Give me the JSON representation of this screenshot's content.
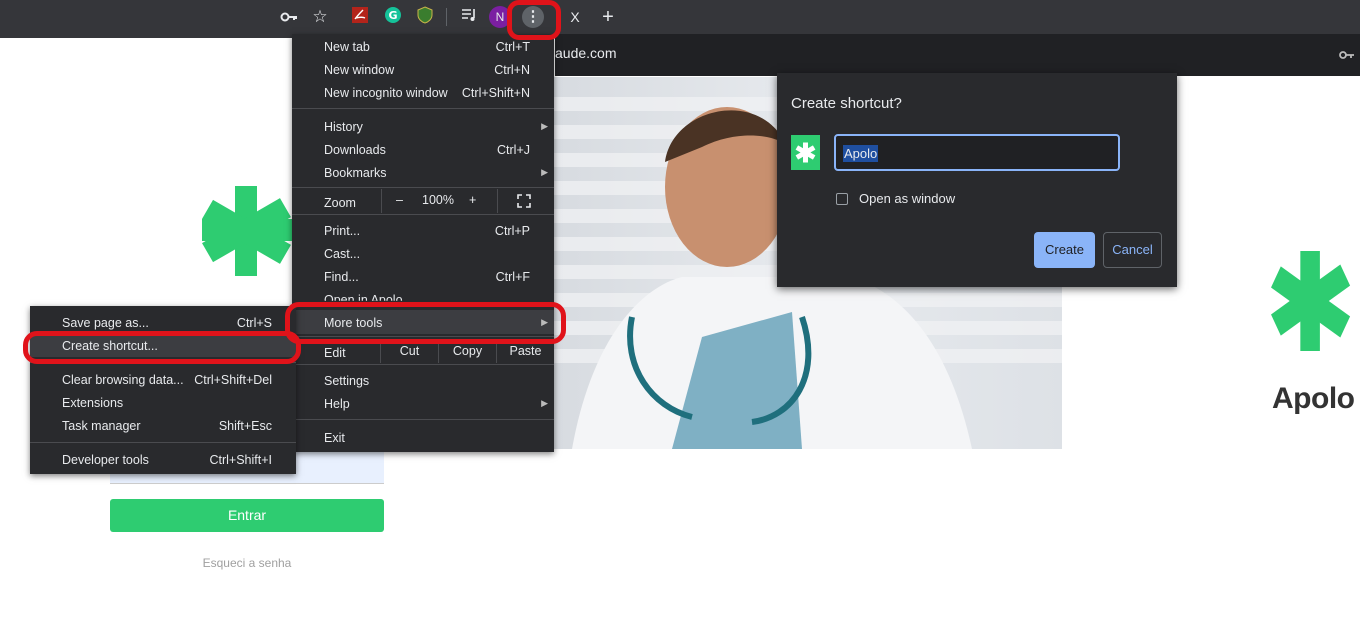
{
  "toolbar": {
    "icons": [
      "key-icon",
      "star-icon",
      "pdf-extension-icon",
      "grammarly-icon",
      "shield-extension-icon",
      "media-control-icon",
      "profile-avatar",
      "menu-dots-icon"
    ],
    "profile_initial": "N",
    "tab_close": "X",
    "new_tab": "+"
  },
  "address": {
    "text": "aude.com"
  },
  "main_menu": {
    "items": [
      {
        "label": "New tab",
        "shortcut": "Ctrl+T"
      },
      {
        "label": "New window",
        "shortcut": "Ctrl+N"
      },
      {
        "label": "New incognito window",
        "shortcut": "Ctrl+Shift+N"
      },
      {
        "label": "History"
      },
      {
        "label": "Downloads",
        "shortcut": "Ctrl+J"
      },
      {
        "label": "Bookmarks"
      },
      {
        "label": "Print...",
        "shortcut": "Ctrl+P"
      },
      {
        "label": "Cast..."
      },
      {
        "label": "Find...",
        "shortcut": "Ctrl+F"
      },
      {
        "label": "Open in Apolo"
      },
      {
        "label": "More tools"
      },
      {
        "label": "Settings"
      },
      {
        "label": "Help"
      },
      {
        "label": "Exit"
      }
    ],
    "zoom": {
      "label": "Zoom",
      "minus": "–",
      "value": "100%",
      "plus": "+"
    },
    "edit": {
      "label": "Edit",
      "cut": "Cut",
      "copy": "Copy",
      "paste": "Paste"
    }
  },
  "sub_menu": {
    "items": [
      {
        "label": "Save page as...",
        "shortcut": "Ctrl+S"
      },
      {
        "label": "Create shortcut..."
      },
      {
        "label": "Clear browsing data...",
        "shortcut": "Ctrl+Shift+Del"
      },
      {
        "label": "Extensions"
      },
      {
        "label": "Task manager",
        "shortcut": "Shift+Esc"
      },
      {
        "label": "Developer tools",
        "shortcut": "Ctrl+Shift+I"
      }
    ]
  },
  "dialog": {
    "title": "Create shortcut?",
    "name_value": "Apolo",
    "open_as_window": "Open as window",
    "create": "Create",
    "cancel": "Cancel"
  },
  "page": {
    "login_button": "Entrar",
    "forgot_password": "Esqueci a senha",
    "brand": "Apolo"
  },
  "colors": {
    "brand_green": "#2ecc71",
    "highlight_red": "#e0131a",
    "dialog_accent": "#8ab4f8"
  }
}
